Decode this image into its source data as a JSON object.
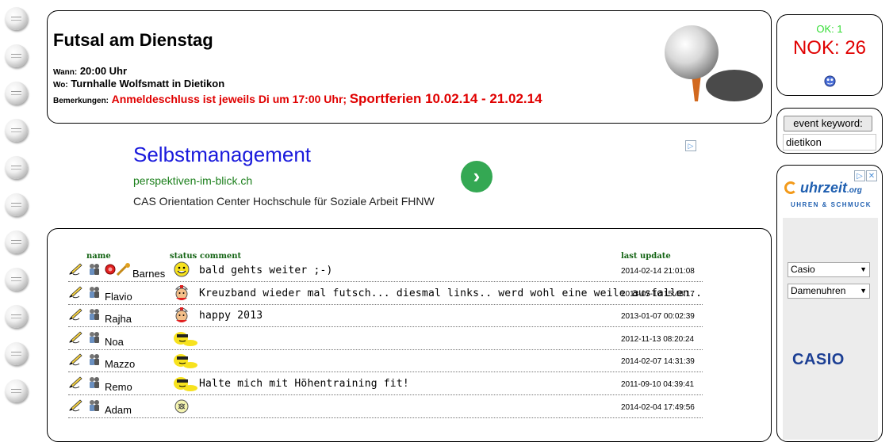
{
  "event": {
    "title": "Futsal am Dienstag",
    "when_label": "Wann:",
    "when_value": "20:00 Uhr",
    "where_label": "Wo:",
    "where_value": "Turnhalle Wolfsmatt in Dietikon",
    "remarks_label": "Bemerkungen:",
    "remarks_value": "Anmeldeschluss ist jeweils Di um 17:00 Uhr;",
    "remarks_highlight": "Sportferien 10.02.14 - 21.02.14"
  },
  "ad": {
    "title": "Selbstmanagement",
    "url": "perspektiven-im-blick.ch",
    "description": "CAS Orientation Center Hochschule für Soziale Arbeit FHNW",
    "go_symbol": "›",
    "adchoices_symbol": "▷"
  },
  "table": {
    "headers": {
      "name": "name",
      "status": "status",
      "comment": "comment",
      "last_update": "last update"
    },
    "rows": [
      {
        "name": "Barnes",
        "status": "happy-face-icon",
        "comment": "bald gehts weiter ;-)",
        "last_update": "2014-02-14 21:01:08",
        "extras": true
      },
      {
        "name": "Flavio",
        "status": "nurse-face-icon",
        "comment": "Kreuzband wieder mal futsch... diesmal links.. werd wohl eine weile ausfallen..",
        "last_update": "2013-07-10 15:48:17",
        "extras": false
      },
      {
        "name": "Rajha",
        "status": "nurse-face-icon",
        "comment": "happy 2013",
        "last_update": "2013-01-07 00:02:39",
        "extras": false
      },
      {
        "name": "Noa",
        "status": "sleeping-face-icon",
        "comment": "",
        "last_update": "2012-11-13 08:20:24",
        "extras": false
      },
      {
        "name": "Mazzo",
        "status": "sleeping-face-icon",
        "comment": "",
        "last_update": "2014-02-07 14:31:39",
        "extras": false
      },
      {
        "name": "Remo",
        "status": "sleeping-face-icon",
        "comment": "Halte mich mit Höhentraining fit!",
        "last_update": "2011-09-10 04:39:41",
        "extras": false
      },
      {
        "name": "Adam",
        "status": "ball-face-icon",
        "comment": "",
        "last_update": "2014-02-04 17:49:56",
        "extras": false
      }
    ]
  },
  "stats": {
    "ok": "OK: 1",
    "nok": "NOK: 26"
  },
  "keyword": {
    "button_label": "event keyword:",
    "value": "dietikon"
  },
  "side_ad": {
    "brand": "uhrzeit",
    "brand_suffix": ".org",
    "tagline": "UHREN & SCHMUCK",
    "select1": "Casio",
    "select2": "Damenuhren",
    "logo": "CASIO",
    "close_symbol": "✕",
    "adchoices_symbol": "▷"
  },
  "colors": {
    "ok": "#33dd33",
    "nok": "#e00000",
    "ad_title": "#1a1adc",
    "ad_url": "#1b7f1b",
    "header_green": "#146414"
  }
}
